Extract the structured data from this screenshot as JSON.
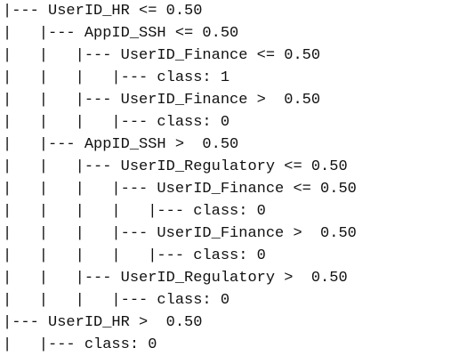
{
  "tree": {
    "lines": [
      "|--- UserID_HR <= 0.50",
      "|   |--- AppID_SSH <= 0.50",
      "|   |   |--- UserID_Finance <= 0.50",
      "|   |   |   |--- class: 1",
      "|   |   |--- UserID_Finance >  0.50",
      "|   |   |   |--- class: 0",
      "|   |--- AppID_SSH >  0.50",
      "|   |   |--- UserID_Regulatory <= 0.50",
      "|   |   |   |--- UserID_Finance <= 0.50",
      "|   |   |   |   |--- class: 0",
      "|   |   |   |--- UserID_Finance >  0.50",
      "|   |   |   |   |--- class: 0",
      "|   |   |--- UserID_Regulatory >  0.50",
      "|   |   |   |--- class: 0",
      "|--- UserID_HR >  0.50",
      "|   |--- class: 0"
    ]
  }
}
